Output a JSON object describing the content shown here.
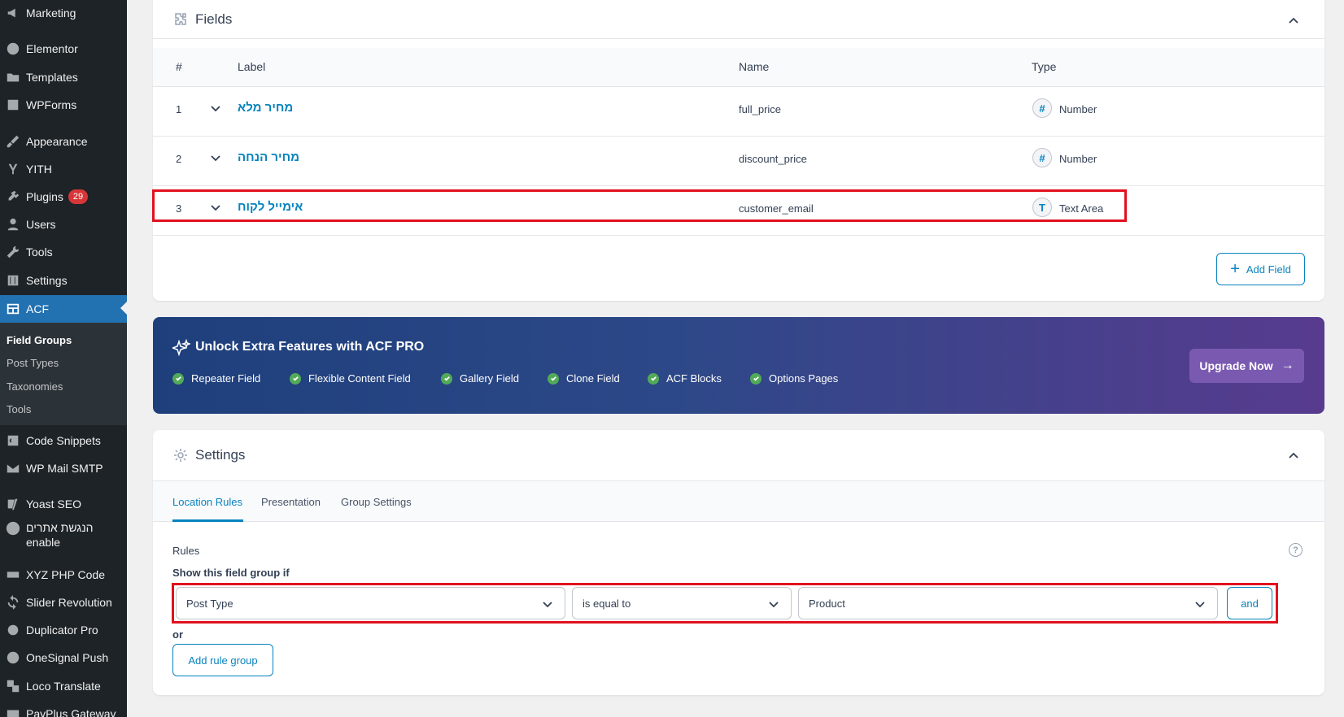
{
  "sidebar": {
    "items": [
      {
        "label": "Marketing"
      },
      {
        "label": "Elementor"
      },
      {
        "label": "Templates"
      },
      {
        "label": "WPForms"
      },
      {
        "label": "Appearance"
      },
      {
        "label": "YITH"
      },
      {
        "label": "Plugins",
        "badge": "29"
      },
      {
        "label": "Users"
      },
      {
        "label": "Tools"
      },
      {
        "label": "Settings"
      },
      {
        "label": "ACF"
      },
      {
        "label": "Code Snippets"
      },
      {
        "label": "WP Mail SMTP"
      },
      {
        "label": "Yoast SEO"
      },
      {
        "label": "הנגשת אתרים enable"
      },
      {
        "label": "XYZ PHP Code"
      },
      {
        "label": "Slider Revolution"
      },
      {
        "label": "Duplicator Pro"
      },
      {
        "label": "OneSignal Push"
      },
      {
        "label": "Loco Translate"
      },
      {
        "label": "PayPlus Gateway"
      }
    ],
    "submenu": [
      "Field Groups",
      "Post Types",
      "Taxonomies",
      "Tools"
    ]
  },
  "fields_panel": {
    "title": "Fields",
    "columns": [
      "#",
      "Label",
      "Name",
      "Type"
    ],
    "rows": [
      {
        "num": "1",
        "label": "מחיר מלא",
        "name": "full_price",
        "type": "Number",
        "type_icon": "#"
      },
      {
        "num": "2",
        "label": "מחיר הנחה",
        "name": "discount_price",
        "type": "Number",
        "type_icon": "#"
      },
      {
        "num": "3",
        "label": "אימייל לקוח",
        "name": "customer_email",
        "type": "Text Area",
        "type_icon": "T"
      }
    ],
    "add_field_label": "Add Field"
  },
  "promo": {
    "title": "Unlock Extra Features with ACF PRO",
    "features": [
      "Repeater Field",
      "Flexible Content Field",
      "Gallery Field",
      "Clone Field",
      "ACF Blocks",
      "Options Pages"
    ],
    "upgrade_label": "Upgrade Now"
  },
  "settings_panel": {
    "title": "Settings",
    "tabs": [
      "Location Rules",
      "Presentation",
      "Group Settings"
    ],
    "rules_label": "Rules",
    "show_if_label": "Show this field group if",
    "rule": {
      "param": "Post Type",
      "operator": "is equal to",
      "value": "Product"
    },
    "and_label": "and",
    "or_label": "or",
    "add_rule_group_label": "Add rule group",
    "help_icon": "?"
  },
  "colors": {
    "sidebar_bg": "#1d2327",
    "accent": "#2271b1",
    "acf_blue": "#0783be",
    "highlight_red": "#e1111e",
    "badge_red": "#d63638"
  }
}
